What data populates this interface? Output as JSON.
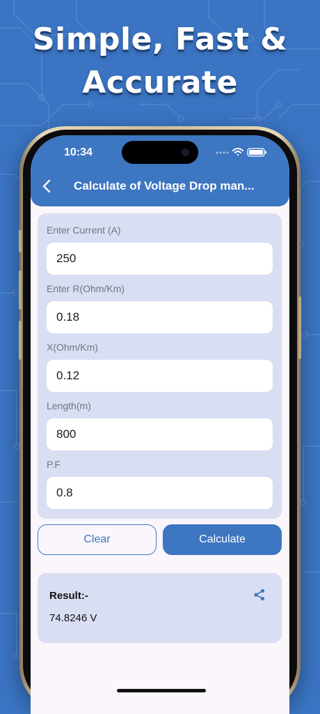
{
  "headline": {
    "line1": "Simple, Fast &",
    "line2": "Accurate"
  },
  "status_bar": {
    "time": "10:34"
  },
  "appbar": {
    "title": "Calculate of Voltage Drop man..."
  },
  "form": {
    "fields": [
      {
        "label": "Enter Current (A)",
        "value": "250"
      },
      {
        "label": "Enter R(Ohm/Km)",
        "value": "0.18"
      },
      {
        "label": "X(Ohm/Km)",
        "value": "0.12"
      },
      {
        "label": "Length(m)",
        "value": "800"
      },
      {
        "label": "P.F",
        "value": "0.8"
      }
    ]
  },
  "actions": {
    "clear_label": "Clear",
    "calculate_label": "Calculate"
  },
  "result": {
    "label": "Result:-",
    "value": "74.8246 V"
  },
  "colors": {
    "background": "#3a74c2",
    "primary": "#3d76c1",
    "card": "#d9def2",
    "screen": "#fbf6fc"
  },
  "icons": {
    "back": "chevron-left-icon",
    "share": "share-icon",
    "wifi": "wifi-icon",
    "battery": "battery-icon",
    "signal": "signal-icon"
  }
}
